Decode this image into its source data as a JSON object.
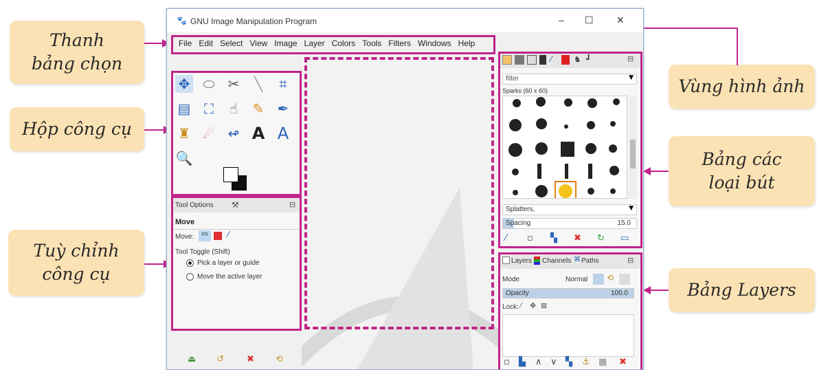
{
  "window": {
    "title": "GNU Image Manipulation Program",
    "controls": [
      "–",
      "☐",
      "✕"
    ]
  },
  "menu": [
    "File",
    "Edit",
    "Select",
    "View",
    "Image",
    "Layer",
    "Colors",
    "Tools",
    "Filters",
    "Windows",
    "Help"
  ],
  "callouts": {
    "menu_bar": "Thanh bảng chọn",
    "toolbox": "Hộp công cụ",
    "tool_options": "Tuỳ chỉnh công cụ",
    "image_area": "Vùng hình ảnh",
    "brushes": "Bảng các loại bút",
    "layers": "Bảng Layers"
  },
  "tool_options": {
    "tabs": "Tool Options",
    "tool_name": "Move",
    "move_label": "Move:",
    "toggle_label": "Tool Toggle  (Shift)",
    "option_pick": "Pick a layer or guide",
    "option_move": "Move the active layer"
  },
  "brushes": {
    "filter_placeholder": "filter",
    "brush_name": "Sparks (60 x 60)",
    "selected_set": "Splatters,",
    "spacing_label": "Spacing",
    "spacing_value": "15.0"
  },
  "layers": {
    "tab_layers": "Layers",
    "tab_channels": "Channels",
    "tab_paths": "Paths",
    "mode_label": "Mode",
    "mode_value": "Normal",
    "opacity_label": "Opacity",
    "opacity_value": "100.0",
    "lock_label": "Lock:"
  },
  "colors": {
    "accent": "#c0248a",
    "callout_bg": "#fbe2b4"
  }
}
